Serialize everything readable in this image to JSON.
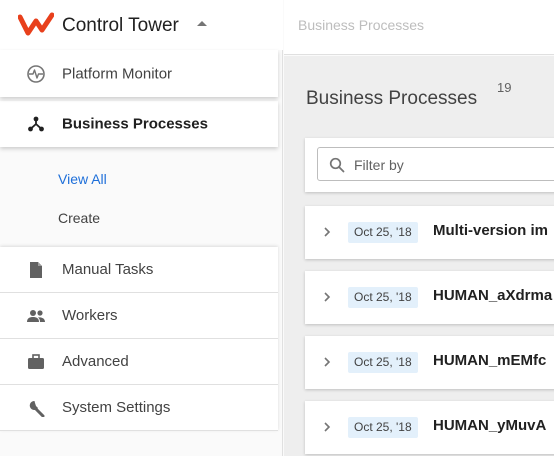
{
  "brand": {
    "title": "Control Tower"
  },
  "sidebar": {
    "primary": [
      {
        "label": "Platform Monitor",
        "icon": "monitor-pulse-icon"
      },
      {
        "label": "Business Processes",
        "icon": "workflow-icon"
      }
    ],
    "sub": [
      {
        "label": "View All"
      },
      {
        "label": "Create"
      }
    ],
    "items": [
      {
        "label": "Manual Tasks",
        "icon": "document-icon"
      },
      {
        "label": "Workers",
        "icon": "people-icon"
      },
      {
        "label": "Advanced",
        "icon": "briefcase-icon"
      },
      {
        "label": "System Settings",
        "icon": "wrench-icon"
      }
    ]
  },
  "header": {
    "breadcrumb": "Business Processes"
  },
  "main": {
    "title": "Business Processes",
    "count": "19",
    "filter": {
      "placeholder": "Filter by"
    },
    "rows": [
      {
        "date": "Oct 25, '18",
        "name": "Multi-version im"
      },
      {
        "date": "Oct 25, '18",
        "name": "HUMAN_aXdrma"
      },
      {
        "date": "Oct 25, '18",
        "name": "HUMAN_mEMfc"
      },
      {
        "date": "Oct 25, '18",
        "name": "HUMAN_yMuvA"
      }
    ]
  },
  "colors": {
    "brand_red": "#e8401c",
    "link_blue": "#1e6fd9",
    "date_badge_bg": "#e3f0fb"
  }
}
